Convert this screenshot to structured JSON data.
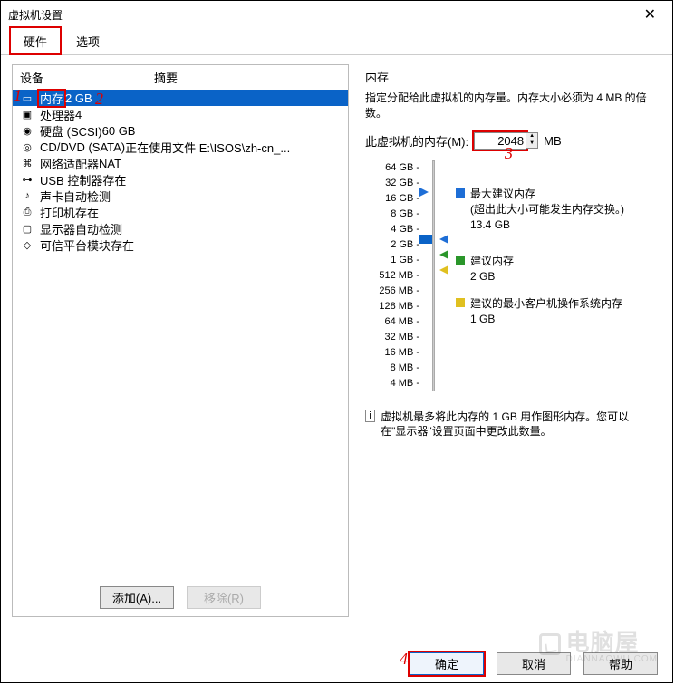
{
  "title": "虚拟机设置",
  "tabs": {
    "hardware": "硬件",
    "options": "选项"
  },
  "list": {
    "head_device": "设备",
    "head_summary": "摘要",
    "items": [
      {
        "icon": "chip",
        "label": "内存",
        "value": "2 GB",
        "selected": true
      },
      {
        "icon": "cpu",
        "label": "处理器",
        "value": "4"
      },
      {
        "icon": "disk",
        "label": "硬盘 (SCSI)",
        "value": "60 GB"
      },
      {
        "icon": "cd",
        "label": "CD/DVD (SATA)",
        "value": "正在使用文件 E:\\ISOS\\zh-cn_..."
      },
      {
        "icon": "net",
        "label": "网络适配器",
        "value": "NAT"
      },
      {
        "icon": "usb",
        "label": "USB 控制器",
        "value": "存在"
      },
      {
        "icon": "snd",
        "label": "声卡",
        "value": "自动检测"
      },
      {
        "icon": "prn",
        "label": "打印机",
        "value": "存在"
      },
      {
        "icon": "mon",
        "label": "显示器",
        "value": "自动检测"
      },
      {
        "icon": "tpm",
        "label": "可信平台模块",
        "value": "存在"
      }
    ],
    "add_btn": "添加(A)...",
    "remove_btn": "移除(R)"
  },
  "right": {
    "heading": "内存",
    "desc": "指定分配给此虚拟机的内存量。内存大小必须为 4 MB 的倍数。",
    "field_label": "此虚拟机的内存(M):",
    "field_value": "2048",
    "unit": "MB",
    "ticks": [
      "64 GB",
      "32 GB",
      "16 GB",
      "8 GB",
      "4 GB",
      "2 GB",
      "1 GB",
      "512 MB",
      "256 MB",
      "128 MB",
      "64 MB",
      "32 MB",
      "16 MB",
      "8 MB",
      "4 MB"
    ],
    "legend": {
      "max_label": "最大建议内存",
      "max_note": "(超出此大小可能发生内存交换。)",
      "max_val": "13.4 GB",
      "rec_label": "建议内存",
      "rec_val": "2 GB",
      "min_label": "建议的最小客户机操作系统内存",
      "min_val": "1 GB"
    },
    "info": "虚拟机最多将此内存的 1 GB 用作图形内存。您可以在\"显示器\"设置页面中更改此数量。"
  },
  "footer": {
    "ok": "确定",
    "cancel": "取消",
    "help": "帮助"
  },
  "annot": {
    "a1": "1",
    "a2": "2",
    "a3": "3",
    "a4": "4"
  },
  "watermark": {
    "main": "电脑屋",
    "sub": "DIANNAOWU.COM"
  }
}
